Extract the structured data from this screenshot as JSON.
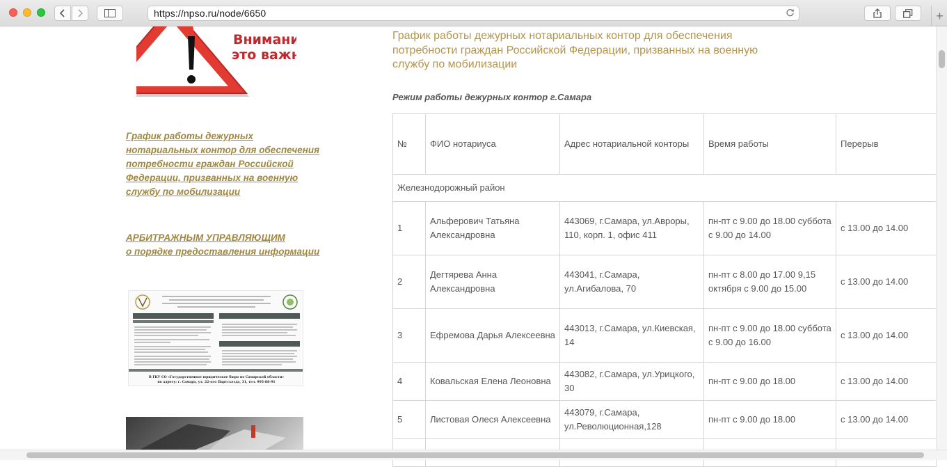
{
  "browser": {
    "url": "https://npso.ru/node/6650"
  },
  "sidebar": {
    "warning_text": [
      "Внимание",
      "это важно!"
    ],
    "link1": "График работы дежурных нотариальных контор для обеспечения потребности граждан Российской Федерации, призванных на военную службу по мобилизации",
    "link2_line1": "АРБИТРАЖНЫМ УПРАВЛЯЮЩИМ",
    "link2_line2": "о порядке предоставления информации",
    "doc_footer_line1": "В ГКУ СО «Государственное юридическое бюро по Самарской области»",
    "doc_footer_line2": "по адресу: г. Самара, ул. 22-ого Партсъезда, 31, тел. 995-88-91"
  },
  "main": {
    "title": "График работы дежурных нотариальных контор для обеспечения потребности граждан Российской Федерации, призванных на военную службу по мобилизации",
    "subtitle": "Режим работы дежурных контор г.Самара",
    "table": {
      "headers": [
        "№",
        "ФИО нотариуса",
        "Адрес нотариальной конторы",
        "Время работы",
        "Перерыв"
      ],
      "district": "Железнодорожный район",
      "rows": [
        {
          "num": "1",
          "name": "Альферович Татьяна Александровна",
          "address": "443069, г.Самара, ул.Авроры, 110, корп. 1, офис 411",
          "hours": "пн-пт с 9.00 до 18.00 суббота с 9.00 до 14.00",
          "break": "с 13.00 до 14.00"
        },
        {
          "num": "2",
          "name": "Дегтярева Анна Александровна",
          "address": "443041, г.Самара, ул.Агибалова, 70",
          "hours": "пн-пт с 8.00 до 17.00 9,15 октября  с 9.00 до 15.00",
          "break": "с 13.00 до 14.00"
        },
        {
          "num": "3",
          "name": "Ефремова Дарья Алексеевна",
          "address": "443013, г.Самара, ул.Киевская, 14",
          "hours": "пн-пт с 9.00 до 18.00 суббота с 9.00 до 16.00",
          "break": "с 13.00 до 14.00"
        },
        {
          "num": "4",
          "name": "Ковальская Елена Леоновна",
          "address": "443082, г.Самара, ул.Урицкого, 30",
          "hours": "пн-пт с 9.00 до 18.00",
          "break": "с 13.00 до 14.00"
        },
        {
          "num": "5",
          "name": "Листовая Олеся Алексеевна",
          "address": "443079, г.Самара, ул.Революционная,128",
          "hours": "пн-пт с 9.00 до 18.00",
          "break": "с 13.00 до 14.00"
        }
      ]
    }
  },
  "colors": {
    "link": "#a2883c",
    "title": "#b3954c",
    "warning_red": "#d32f2f",
    "warning_text": "#c0282d"
  }
}
